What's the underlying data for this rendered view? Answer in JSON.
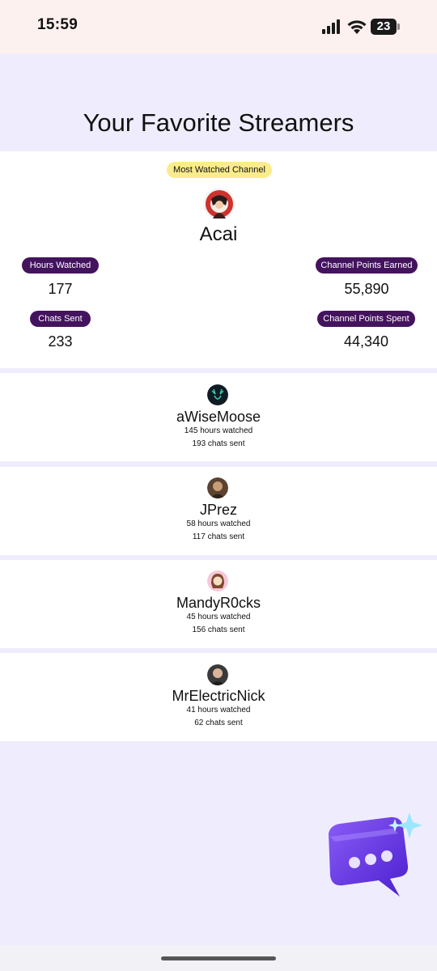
{
  "status_bar": {
    "time": "15:59",
    "battery": "23"
  },
  "page_title": "Your Favorite Streamers",
  "top_streamer": {
    "badge": "Most Watched Channel",
    "name": "Acai",
    "stats": {
      "hours_watched_label": "Hours Watched",
      "hours_watched": "177",
      "chats_sent_label": "Chats Sent",
      "chats_sent": "233",
      "points_earned_label": "Channel Points Earned",
      "points_earned": "55,890",
      "points_spent_label": "Channel Points Spent",
      "points_spent": "44,340"
    }
  },
  "streamers": [
    {
      "name": "aWiseMoose",
      "hours": "145 hours watched",
      "chats": "193 chats sent"
    },
    {
      "name": "JPrez",
      "hours": "58 hours watched",
      "chats": "117 chats sent"
    },
    {
      "name": "MandyR0cks",
      "hours": "45 hours watched",
      "chats": "156 chats sent"
    },
    {
      "name": "MrElectricNick",
      "hours": "41 hours watched",
      "chats": "62 chats sent"
    }
  ],
  "colors": {
    "background": "#efedfd",
    "status_bar": "#fdf1ef",
    "badge_yellow": "#faec8c",
    "stat_pill": "#44135e",
    "sticker_purple": "#6a3ee8"
  },
  "icons": [
    "signal-icon",
    "wifi-icon",
    "battery-icon",
    "chat-bubble-sticker"
  ]
}
